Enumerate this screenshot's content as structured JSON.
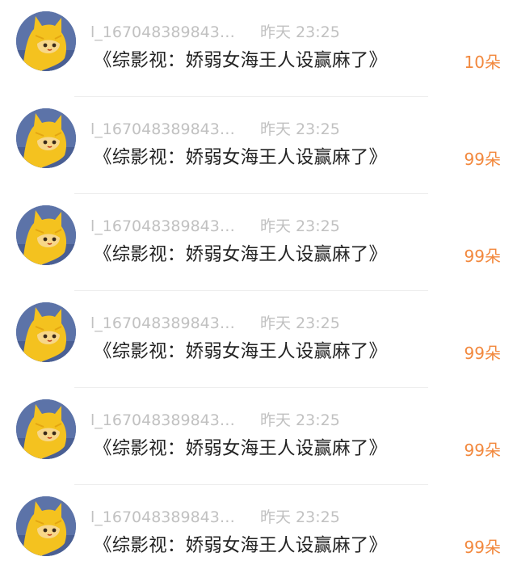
{
  "items": [
    {
      "username": "l_167048389843…",
      "time": "昨天 23:25",
      "title": "《综影视：娇弱女海王人设赢麻了》",
      "count": "10朵"
    },
    {
      "username": "l_167048389843…",
      "time": "昨天 23:25",
      "title": "《综影视：娇弱女海王人设赢麻了》",
      "count": "99朵"
    },
    {
      "username": "l_167048389843…",
      "time": "昨天 23:25",
      "title": "《综影视：娇弱女海王人设赢麻了》",
      "count": "99朵"
    },
    {
      "username": "l_167048389843…",
      "time": "昨天 23:25",
      "title": "《综影视：娇弱女海王人设赢麻了》",
      "count": "99朵"
    },
    {
      "username": "l_167048389843…",
      "time": "昨天 23:25",
      "title": "《综影视：娇弱女海王人设赢麻了》",
      "count": "99朵"
    },
    {
      "username": "l_167048389843…",
      "time": "昨天 23:25",
      "title": "《综影视：娇弱女海王人设赢麻了》",
      "count": "99朵"
    }
  ],
  "avatar_icon": "yellow-cartoon-cat-avatar-icon",
  "colors": {
    "count_accent": "#f2883d",
    "meta_text": "#c1c1c1",
    "title_text": "#222222",
    "avatar_bg": "#5c73a8",
    "avatar_figure": "#f4c21f"
  }
}
